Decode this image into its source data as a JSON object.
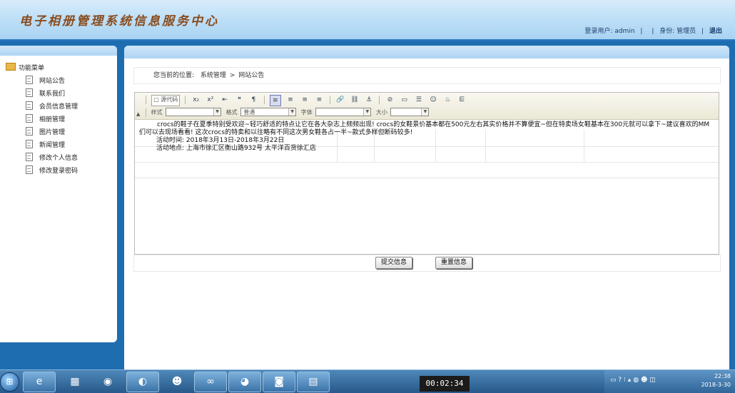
{
  "header": {
    "app_title": "电子相册管理系统信息服务中心",
    "user_label": "登录用户:",
    "user_name": "admin",
    "sep": "|",
    "role_label": "身份:",
    "role": "管理员",
    "logout": "退出"
  },
  "sidebar": {
    "title": "功能菜单",
    "items": [
      "网站公告",
      "联系我们",
      "会员信息管理",
      "相册管理",
      "图片管理",
      "新闻管理",
      "修改个人信息",
      "修改登录密码"
    ]
  },
  "breadcrumb": {
    "prefix": "您当前的位置:",
    "section": "系统管理",
    "arrow": ">",
    "page": "网站公告"
  },
  "editor": {
    "toolbar": {
      "source_label": "源代码",
      "style_label": "样式",
      "format_label": "格式",
      "format_value": "普通",
      "font_label": "字体",
      "size_label": "大小",
      "collapse": "▲",
      "icons": [
        "subscript-icon",
        "superscript-icon",
        "outdent-icon",
        "blockquote-icon",
        "div-icon",
        "align-left-icon",
        "align-center-icon",
        "align-right-icon",
        "justify-icon",
        "link-icon",
        "unlink-icon",
        "anchor-icon",
        "flash-icon",
        "table-icon",
        "hr-icon",
        "smiley-icon",
        "special-char-icon",
        "page-break-icon"
      ]
    },
    "content": {
      "p1": "crocs的鞋子在夏季特别受欢迎~轻巧舒适的特点让它在各大杂志上频频出现! crocs的女鞋景价基本都在500元左右其实价格并不算便宜~但在特卖场女鞋基本在300元就可以拿下~建议喜欢的MM们可以去现场看看! 这次crocs的特卖和以往略有不同这次男女鞋各占一半~款式多样但断码较多!",
      "p2": "活动时间: 2018年3月13日-2018年3月22日",
      "p3": "活动地点: 上海市徐汇区衡山路932号 太平洋百货徐汇店"
    }
  },
  "actions": {
    "submit": "提交信息",
    "reset": "重置信息"
  },
  "taskbar": {
    "timer": "00:02:34",
    "clock_time": "22:38",
    "clock_date": "2018-3-30"
  }
}
